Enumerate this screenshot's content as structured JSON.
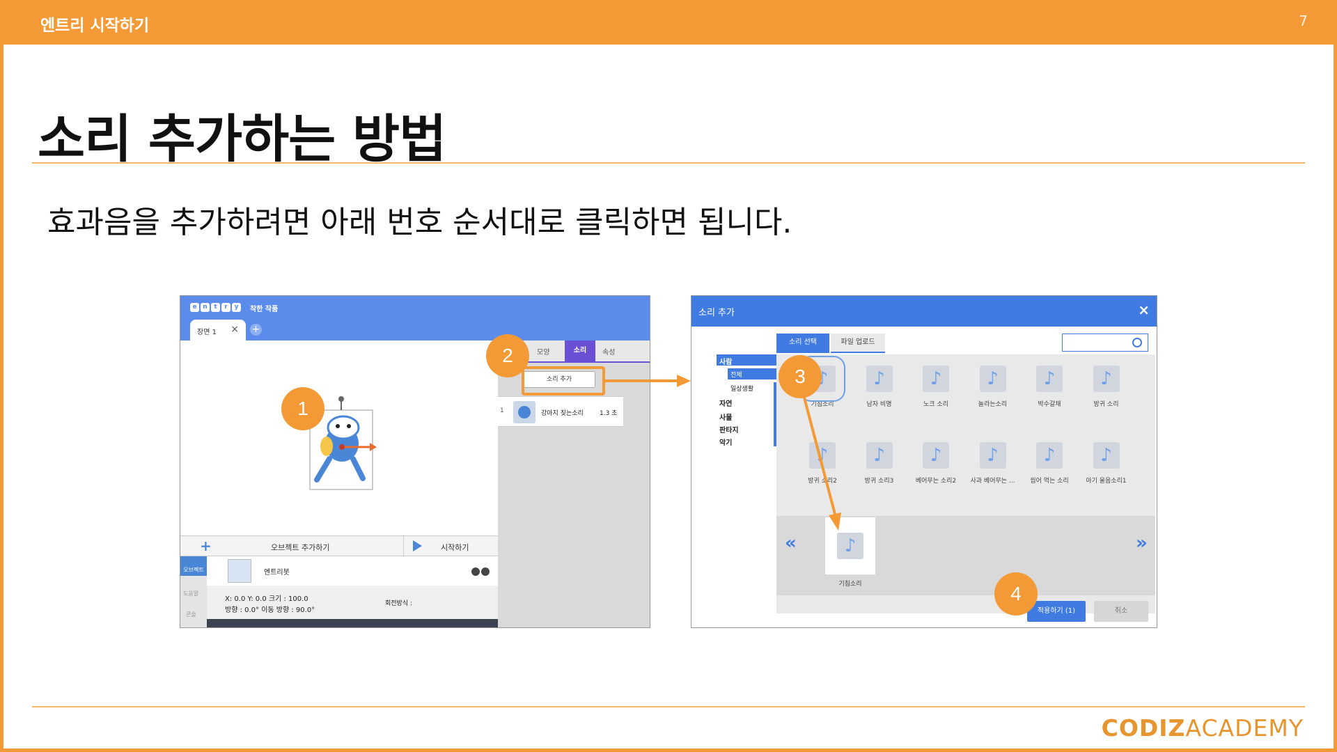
{
  "header": {
    "title": "엔트리 시작하기",
    "page_number": "7"
  },
  "slide": {
    "heading": "소리 추가하는 방법",
    "subtitle": "효과음을 추가하려면 아래 번호 순서대로 클릭하면 됩니다."
  },
  "brand": {
    "part1": "CODIZ",
    "part2": "ACADEMY"
  },
  "badges": [
    "1",
    "2",
    "3",
    "4"
  ],
  "editor": {
    "logo_letters": [
      "e",
      "n",
      "t",
      "r",
      "y"
    ],
    "project_name": "착한 작품",
    "scene_tab": "장면 1",
    "tabs": [
      "모양",
      "소리",
      "속성"
    ],
    "active_tab": "소리",
    "add_sound_button": "소리 추가",
    "sound_item": {
      "index": "1",
      "name": "강아지 짖는소리",
      "duration": "1.3 초"
    },
    "add_object": "오브젝트 추가하기",
    "start": "시작하기",
    "left_nav": [
      "오브젝트",
      "도움말",
      "콘솔"
    ],
    "object_name": "엔트리봇",
    "props_line1": "X: 0.0     Y: 0.0     크기 : 100.0",
    "props_line2": "방향 : 0.0°    이동 방향 : 90.0°",
    "rotation_label": "회전방식 :"
  },
  "dialog": {
    "title": "소리 추가",
    "close": "×",
    "tabs": [
      "소리 선택",
      "파일 업로드"
    ],
    "categories": [
      "사람",
      "자연",
      "사물",
      "판타지",
      "악기"
    ],
    "subcategories": [
      "전체",
      "일상생활"
    ],
    "sounds_row1": [
      "기침소리",
      "남자 비명",
      "노크 소리",
      "놀라는소리",
      "박수갈채",
      "방귀 소리"
    ],
    "sounds_row2": [
      "방귀 소리2",
      "방귀 소리3",
      "베어무는 소리2",
      "사과 베어무는 ...",
      "씹어 먹는 소리",
      "아기 울음소리1"
    ],
    "selected_sound": "기침소리",
    "note_glyph": "♪",
    "prev": "«",
    "next": "»",
    "apply_button": "적용하기 (1)",
    "cancel_button": "취소"
  },
  "colors": {
    "accent": "#F39A36",
    "blue": "#3F7BE0",
    "purple": "#6B4FD4"
  }
}
